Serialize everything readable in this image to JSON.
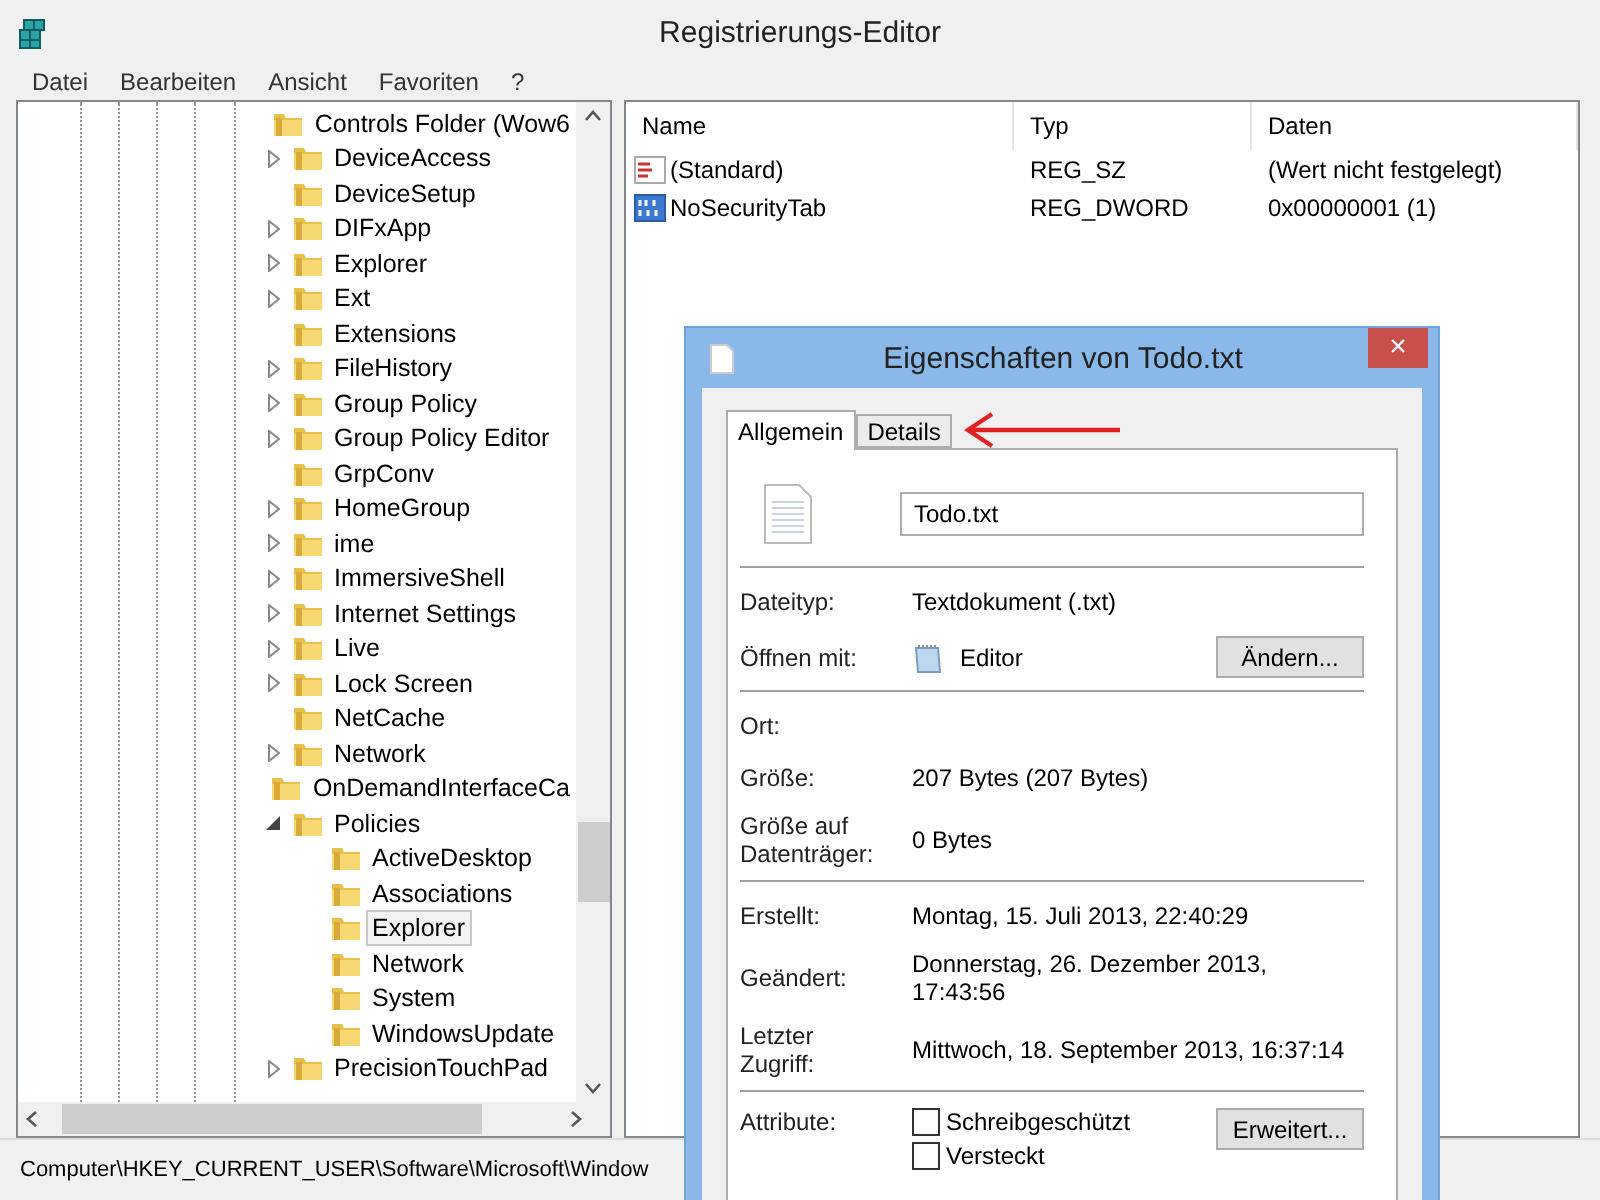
{
  "window": {
    "title": "Registrierungs-Editor"
  },
  "menu": [
    "Datei",
    "Bearbeiten",
    "Ansicht",
    "Favoriten",
    "?"
  ],
  "tree": [
    {
      "label": "Controls Folder (Wow6",
      "expandable": false,
      "selected": false
    },
    {
      "label": "DeviceAccess",
      "expandable": true,
      "expanded": false,
      "selected": false
    },
    {
      "label": "DeviceSetup",
      "expandable": false,
      "selected": false
    },
    {
      "label": "DIFxApp",
      "expandable": true,
      "expanded": false,
      "selected": false
    },
    {
      "label": "Explorer",
      "expandable": true,
      "expanded": false,
      "selected": false
    },
    {
      "label": "Ext",
      "expandable": true,
      "expanded": false,
      "selected": false
    },
    {
      "label": "Extensions",
      "expandable": false,
      "selected": false
    },
    {
      "label": "FileHistory",
      "expandable": true,
      "expanded": false,
      "selected": false
    },
    {
      "label": "Group Policy",
      "expandable": true,
      "expanded": false,
      "selected": false
    },
    {
      "label": "Group Policy Editor",
      "expandable": true,
      "expanded": false,
      "selected": false
    },
    {
      "label": "GrpConv",
      "expandable": false,
      "selected": false
    },
    {
      "label": "HomeGroup",
      "expandable": true,
      "expanded": false,
      "selected": false
    },
    {
      "label": "ime",
      "expandable": true,
      "expanded": false,
      "selected": false
    },
    {
      "label": "ImmersiveShell",
      "expandable": true,
      "expanded": false,
      "selected": false
    },
    {
      "label": "Internet Settings",
      "expandable": true,
      "expanded": false,
      "selected": false
    },
    {
      "label": "Live",
      "expandable": true,
      "expanded": false,
      "selected": false
    },
    {
      "label": "Lock Screen",
      "expandable": true,
      "expanded": false,
      "selected": false
    },
    {
      "label": "NetCache",
      "expandable": false,
      "selected": false
    },
    {
      "label": "Network",
      "expandable": true,
      "expanded": false,
      "selected": false
    },
    {
      "label": "OnDemandInterfaceCa",
      "expandable": false,
      "selected": false
    },
    {
      "label": "Policies",
      "expandable": true,
      "expanded": true,
      "selected": false,
      "children": [
        {
          "label": "ActiveDesktop",
          "expandable": false,
          "selected": false
        },
        {
          "label": "Associations",
          "expandable": false,
          "selected": false
        },
        {
          "label": "Explorer",
          "expandable": false,
          "selected": true
        },
        {
          "label": "Network",
          "expandable": false,
          "selected": false
        },
        {
          "label": "System",
          "expandable": false,
          "selected": false
        },
        {
          "label": "WindowsUpdate",
          "expandable": false,
          "selected": false
        }
      ]
    },
    {
      "label": "PrecisionTouchPad",
      "expandable": true,
      "expanded": false,
      "selected": false
    }
  ],
  "list": {
    "columns": [
      "Name",
      "Typ",
      "Daten"
    ],
    "rows": [
      {
        "kind": "string",
        "name": "(Standard)",
        "type": "REG_SZ",
        "data": "(Wert nicht festgelegt)"
      },
      {
        "kind": "binary",
        "name": "NoSecurityTab",
        "type": "REG_DWORD",
        "data": "0x00000001 (1)"
      }
    ]
  },
  "status_bar": "Computer\\HKEY_CURRENT_USER\\Software\\Microsoft\\Window",
  "dialog": {
    "title": "Eigenschaften von Todo.txt",
    "close": "×",
    "tabs": [
      {
        "label": "Allgemein",
        "selected": true
      },
      {
        "label": "Details",
        "selected": false
      }
    ],
    "file_name": "Todo.txt",
    "sections": [
      [
        {
          "kind": "text",
          "label": "Dateityp:",
          "value": "Textdokument (.txt)"
        },
        {
          "kind": "app",
          "label": "Öffnen mit:",
          "value": "Editor",
          "button": "Ändern..."
        }
      ],
      [
        {
          "kind": "text",
          "label": "Ort:"
        },
        {
          "kind": "text",
          "label": "Größe:",
          "value": "207 Bytes (207 Bytes)"
        },
        {
          "kind": "text",
          "label": "Größe auf Datenträger:",
          "value": "0 Bytes"
        }
      ],
      [
        {
          "kind": "text",
          "label": "Erstellt:",
          "value": "Montag, 15. Juli 2013, 22:40:29"
        },
        {
          "kind": "text",
          "label": "Geändert:",
          "value": "Donnerstag, 26. Dezember 2013, 17:43:56"
        },
        {
          "kind": "text",
          "label": "Letzter Zugriff:",
          "value": "Mittwoch, 18. September 2013, 16:37:14"
        }
      ],
      [
        {
          "kind": "attributes",
          "label": "Attribute:",
          "checkboxes": [
            {
              "label": "Schreibgeschützt",
              "checked": false
            },
            {
              "label": "Versteckt",
              "checked": false
            }
          ],
          "button": "Erweitert..."
        }
      ]
    ]
  }
}
